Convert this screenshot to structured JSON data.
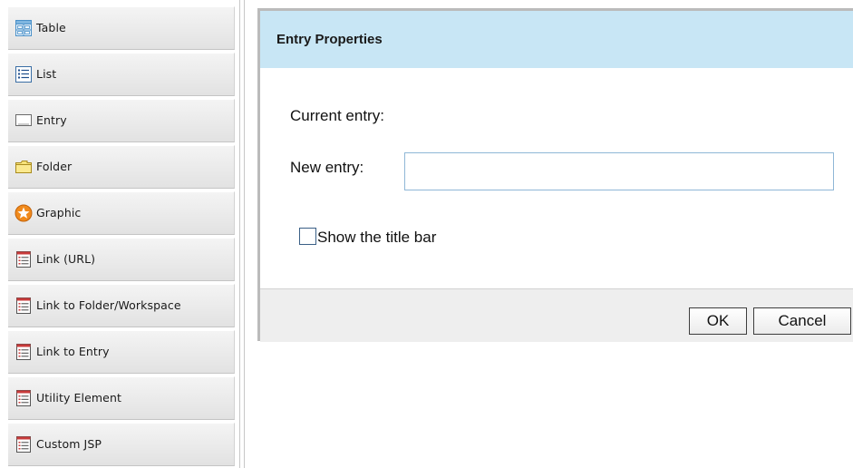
{
  "palette": {
    "items": [
      {
        "label": "Table",
        "icon": "table-icon"
      },
      {
        "label": "List",
        "icon": "list-icon"
      },
      {
        "label": "Entry",
        "icon": "entry-icon"
      },
      {
        "label": "Folder",
        "icon": "folder-icon"
      },
      {
        "label": "Graphic",
        "icon": "graphic-icon"
      },
      {
        "label": "Link (URL)",
        "icon": "link-icon"
      },
      {
        "label": "Link to Folder/Workspace",
        "icon": "link-icon"
      },
      {
        "label": "Link to Entry",
        "icon": "link-icon"
      },
      {
        "label": "Utility Element",
        "icon": "link-icon"
      },
      {
        "label": "Custom JSP",
        "icon": "link-icon"
      }
    ]
  },
  "dialog": {
    "title": "Entry Properties",
    "current_entry_label": "Current entry:",
    "current_entry_value": "",
    "new_entry_label": "New entry:",
    "new_entry_value": "",
    "show_title_bar_label": "Show the title bar",
    "show_title_bar_checked": false,
    "ok_label": "OK",
    "cancel_label": "Cancel"
  },
  "colors": {
    "dialog_header_bg": "#c8e6f5",
    "dialog_border": "#bbbbbb",
    "footer_bg": "#eeeeee",
    "input_border": "#8fb7d6"
  }
}
